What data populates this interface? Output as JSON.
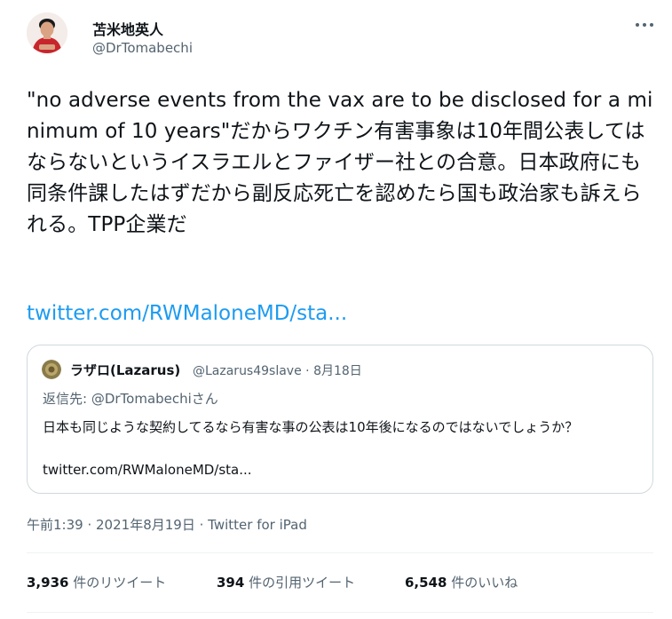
{
  "author": {
    "name": "苫米地英人",
    "handle": "@DrTomabechi"
  },
  "tweet": {
    "text": "\"no adverse events from the vax are to be disclosed for a minimum of 10 years\"だからワクチン有害事象は10年間公表してはならないというイスラエルとファイザー社との合意。日本政府にも同条件課したはずだから副反応死亡を認めたら国も政治家も訴えられる。TPP企業だ",
    "link": "twitter.com/RWMaloneMD/sta..."
  },
  "quote": {
    "name": "ラザロ(Lazarus)",
    "handle": "@Lazarus49slave",
    "date": "8月18日",
    "reply_prefix": "返信先: ",
    "reply_mention": "@DrTomabechiさん",
    "text": "日本も同じような契約してるなら有害な事の公表は10年後になるのではないでしょうか？",
    "link": "twitter.com/RWMaloneMD/sta..."
  },
  "timestamp": {
    "time": "午前1:39",
    "date": "2021年8月19日",
    "source": "Twitter for iPad"
  },
  "stats": {
    "retweets_count": "3,936",
    "retweets_label": "件のリツイート",
    "quotes_count": "394",
    "quotes_label": "件の引用ツイート",
    "likes_count": "6,548",
    "likes_label": "件のいいね"
  },
  "colors": {
    "link": "#1d9bf0",
    "secondary_text": "#536471",
    "border": "#cfd9de"
  },
  "icons": [
    "more-icon"
  ]
}
